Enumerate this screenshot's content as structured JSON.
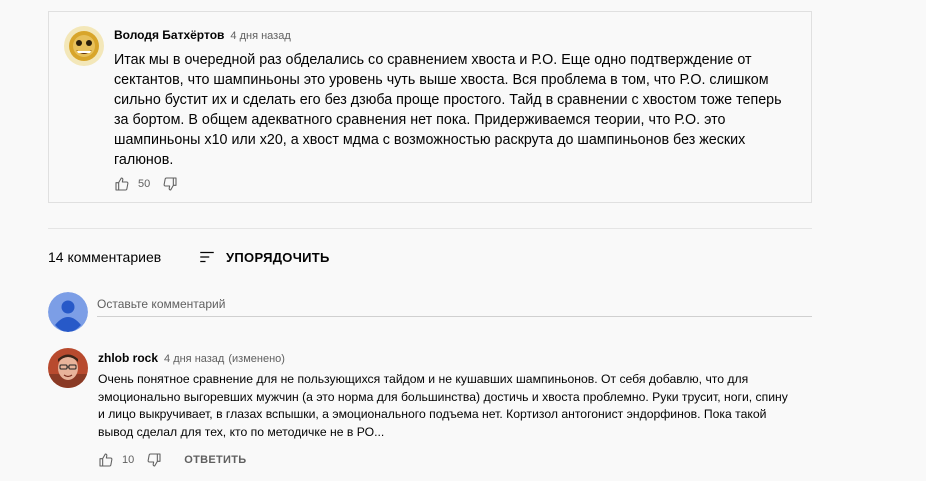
{
  "pinned_comment": {
    "author": "Володя Батхёртов",
    "time": "4 дня назад",
    "text": "Итак мы в очередной раз обделались со сравнением хвоста и Р.О. Еще одно подтверждение от сектантов, что шампиньоны это уровень чуть выше хвоста. Вся проблема в том, что Р.О. слишком сильно бустит их и сделать его без дзюба проще простого. Тайд в сравнении с хвостом тоже теперь за бортом. В общем адекватного сравнения нет пока. Придерживаемся теории, что Р.О. это шампиньоны х10 или х20, а хвост мдма с возможностью раскрута до шампиньонов без жеских галюнов.",
    "likes": "50"
  },
  "comments_header": {
    "count_label": "14 комментариев",
    "sort_label": "УПОРЯДОЧИТЬ"
  },
  "new_comment": {
    "placeholder": "Оставьте комментарий"
  },
  "comment": {
    "author": "zhlob rock",
    "time": "4 дня назад",
    "edited": "(изменено)",
    "text": "Очень понятное сравнение для не пользующихся тайдом и не кушавших шампиньонов. От себя добавлю, что для эмоционально выгоревших мужчин (а это норма для большинства) достичь и хвоста проблемно. Руки трусит, ноги, спину и лицо выкручивает, в глазах вспышки, а эмоционального подъема нет. Кортизол антогонист эндорфинов. Пока такой вывод сделал для тех, кто по методичке не в РО...",
    "likes": "10",
    "reply_label": "ОТВЕТИТЬ"
  },
  "colors": {
    "background": "#f9f9f9",
    "text": "#030303",
    "secondary_text": "#606060",
    "default_avatar": "#7c9ee6"
  },
  "icons": [
    "thumb-up-icon",
    "thumb-down-icon",
    "sort-icon",
    "default-avatar-icon"
  ]
}
